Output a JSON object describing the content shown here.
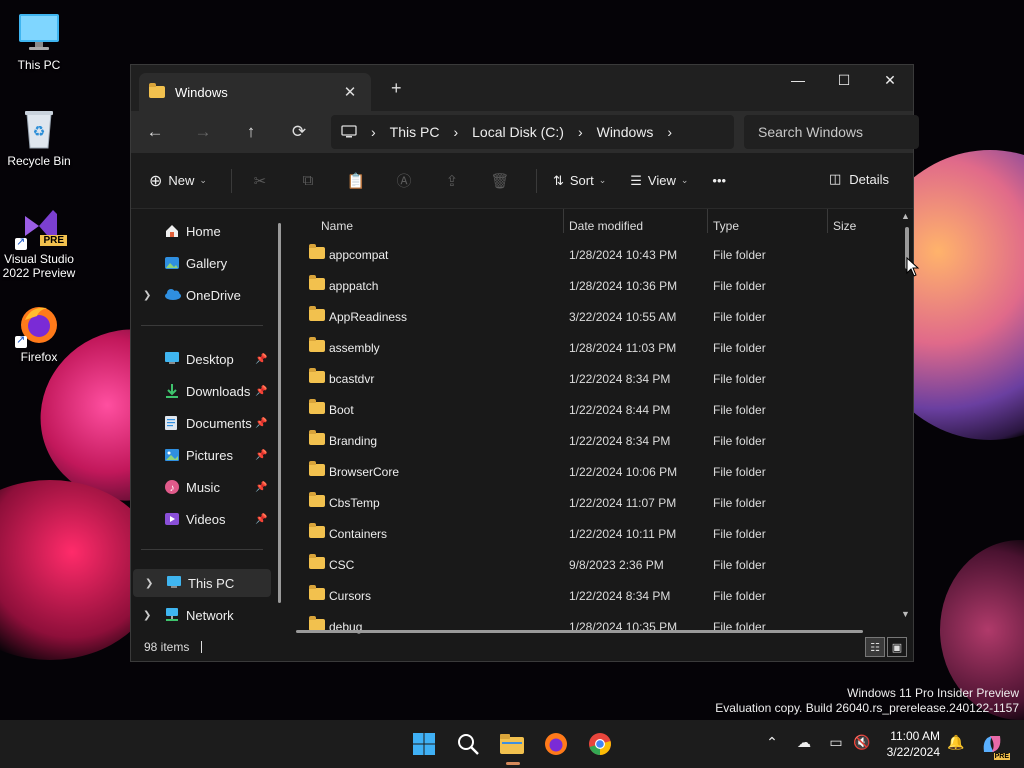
{
  "desktop": {
    "icons": [
      {
        "label": "This PC"
      },
      {
        "label": "Recycle Bin"
      },
      {
        "label": "Visual Studio 2022 Preview",
        "badge": "PRE"
      },
      {
        "label": "Firefox"
      }
    ]
  },
  "window": {
    "tab_title": "Windows",
    "tab_close": "✕",
    "new_tab": "+",
    "controls": {
      "minimize": "—",
      "maximize": "☐",
      "close": "✕"
    },
    "nav": {
      "back": "←",
      "forward": "→",
      "up": "↑",
      "refresh": "⟳"
    },
    "breadcrumb": [
      "This PC",
      "Local Disk (C:)",
      "Windows"
    ],
    "search_placeholder": "Search Windows",
    "commands": {
      "new": "New",
      "sort": "Sort",
      "view": "View",
      "more": "•••",
      "details": "Details"
    },
    "sidebar": {
      "items": [
        {
          "label": "Home"
        },
        {
          "label": "Gallery"
        },
        {
          "label": "OneDrive"
        },
        {
          "label": "Desktop"
        },
        {
          "label": "Downloads"
        },
        {
          "label": "Documents"
        },
        {
          "label": "Pictures"
        },
        {
          "label": "Music"
        },
        {
          "label": "Videos"
        },
        {
          "label": "This PC"
        },
        {
          "label": "Network"
        }
      ]
    },
    "columns": {
      "name": "Name",
      "date": "Date modified",
      "type": "Type",
      "size": "Size"
    },
    "files": [
      {
        "name": "appcompat",
        "date": "1/28/2024 10:43 PM",
        "type": "File folder"
      },
      {
        "name": "apppatch",
        "date": "1/28/2024 10:36 PM",
        "type": "File folder"
      },
      {
        "name": "AppReadiness",
        "date": "3/22/2024 10:55 AM",
        "type": "File folder"
      },
      {
        "name": "assembly",
        "date": "1/28/2024 11:03 PM",
        "type": "File folder"
      },
      {
        "name": "bcastdvr",
        "date": "1/22/2024 8:34 PM",
        "type": "File folder"
      },
      {
        "name": "Boot",
        "date": "1/22/2024 8:44 PM",
        "type": "File folder"
      },
      {
        "name": "Branding",
        "date": "1/22/2024 8:34 PM",
        "type": "File folder"
      },
      {
        "name": "BrowserCore",
        "date": "1/22/2024 10:06 PM",
        "type": "File folder"
      },
      {
        "name": "CbsTemp",
        "date": "1/22/2024 11:07 PM",
        "type": "File folder"
      },
      {
        "name": "Containers",
        "date": "1/22/2024 10:11 PM",
        "type": "File folder"
      },
      {
        "name": "CSC",
        "date": "9/8/2023 2:36 PM",
        "type": "File folder"
      },
      {
        "name": "Cursors",
        "date": "1/22/2024 8:34 PM",
        "type": "File folder"
      },
      {
        "name": "debug",
        "date": "1/28/2024 10:35 PM",
        "type": "File folder"
      }
    ],
    "status": "98 items"
  },
  "watermark": {
    "line1": "Windows 11 Pro Insider Preview",
    "line2": "Evaluation copy. Build 26040.rs_prerelease.240122-1157"
  },
  "taskbar": {
    "clock_time": "11:00 AM",
    "clock_date": "3/22/2024",
    "copilot_badge": "PRE"
  },
  "colors": {
    "accent": "#d68a5b",
    "folder": "#f2c14e"
  }
}
